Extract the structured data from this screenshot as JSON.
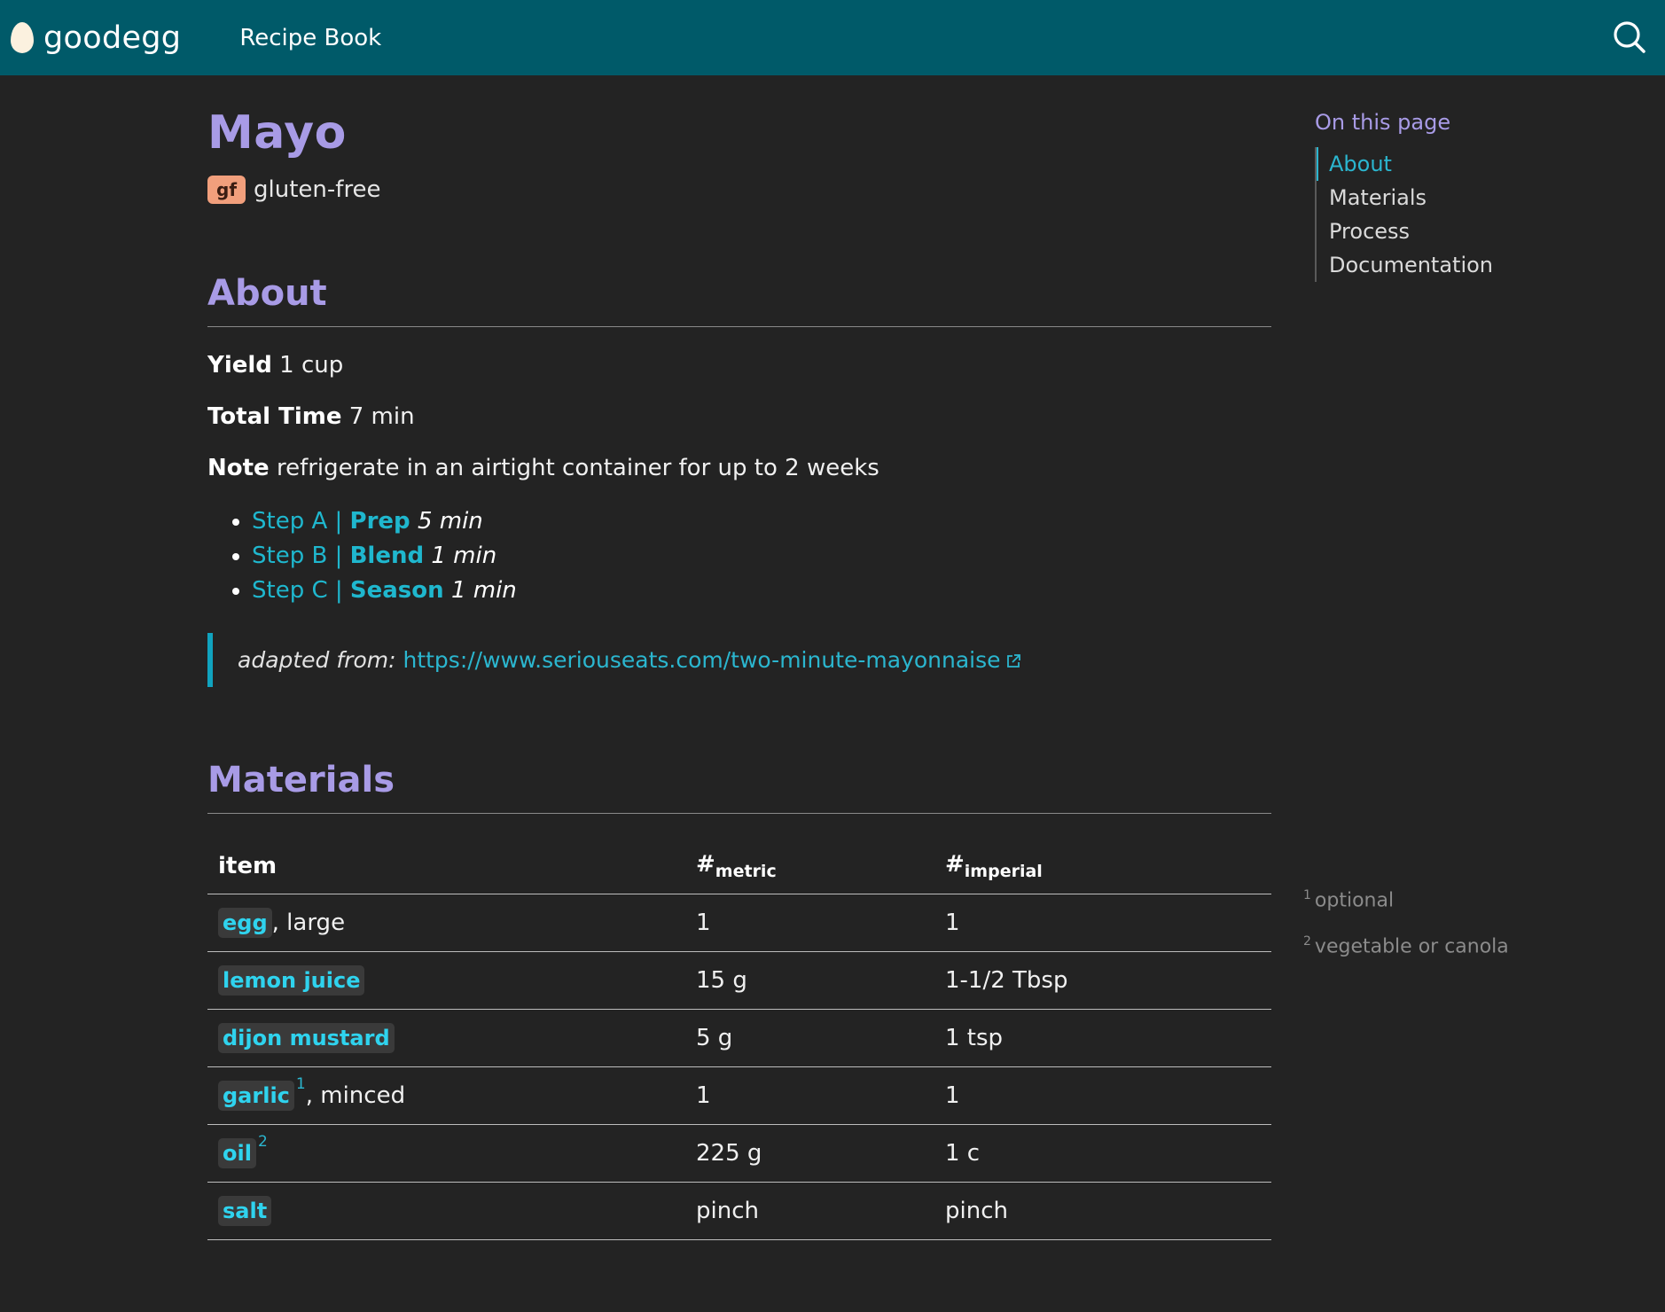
{
  "header": {
    "logo_text": "goodegg",
    "nav_title": "Recipe Book",
    "search_icon": "search-icon"
  },
  "page": {
    "title": "Mayo",
    "tag_badge": "gf",
    "tag_label": "gluten-free"
  },
  "about": {
    "heading": "About",
    "yield_label": "Yield",
    "yield_value": "1 cup",
    "time_label": "Total Time",
    "time_value": "7 min",
    "note_label": "Note",
    "note_value": "refrigerate in an airtight container for up to 2 weeks",
    "steps": [
      {
        "prefix": "Step A | ",
        "name": "Prep",
        "time": "5 min"
      },
      {
        "prefix": "Step B | ",
        "name": "Blend",
        "time": "1 min"
      },
      {
        "prefix": "Step C | ",
        "name": "Season",
        "time": "1 min"
      }
    ],
    "adapted_label": "adapted from:",
    "adapted_url": "https://www.seriouseats.com/two-minute-mayonnaise"
  },
  "materials": {
    "heading": "Materials",
    "columns": {
      "item": "item",
      "metric_hash": "#",
      "metric_sub": "metric",
      "imperial_hash": "#",
      "imperial_sub": "imperial"
    },
    "rows": [
      {
        "item": "egg",
        "suffix": ", large",
        "footnote": "",
        "metric": "1",
        "imperial": "1"
      },
      {
        "item": "lemon juice",
        "suffix": "",
        "footnote": "",
        "metric": "15 g",
        "imperial": "1-1/2 Tbsp"
      },
      {
        "item": "dijon mustard",
        "suffix": "",
        "footnote": "",
        "metric": "5 g",
        "imperial": "1 tsp"
      },
      {
        "item": "garlic",
        "suffix": ", minced",
        "footnote": "1",
        "metric": "1",
        "imperial": "1"
      },
      {
        "item": "oil",
        "suffix": "",
        "footnote": "2",
        "metric": "225 g",
        "imperial": "1 c"
      },
      {
        "item": "salt",
        "suffix": "",
        "footnote": "",
        "metric": "pinch",
        "imperial": "pinch"
      }
    ],
    "footnotes": [
      {
        "num": "1",
        "text": "optional"
      },
      {
        "num": "2",
        "text": "vegetable or canola"
      }
    ]
  },
  "toc": {
    "title": "On this page",
    "items": [
      "About",
      "Materials",
      "Process",
      "Documentation"
    ]
  },
  "colors": {
    "header_bg": "#005a69",
    "heading": "#a89be6",
    "link": "#2bb6cf",
    "badge": "#f19f7c"
  }
}
